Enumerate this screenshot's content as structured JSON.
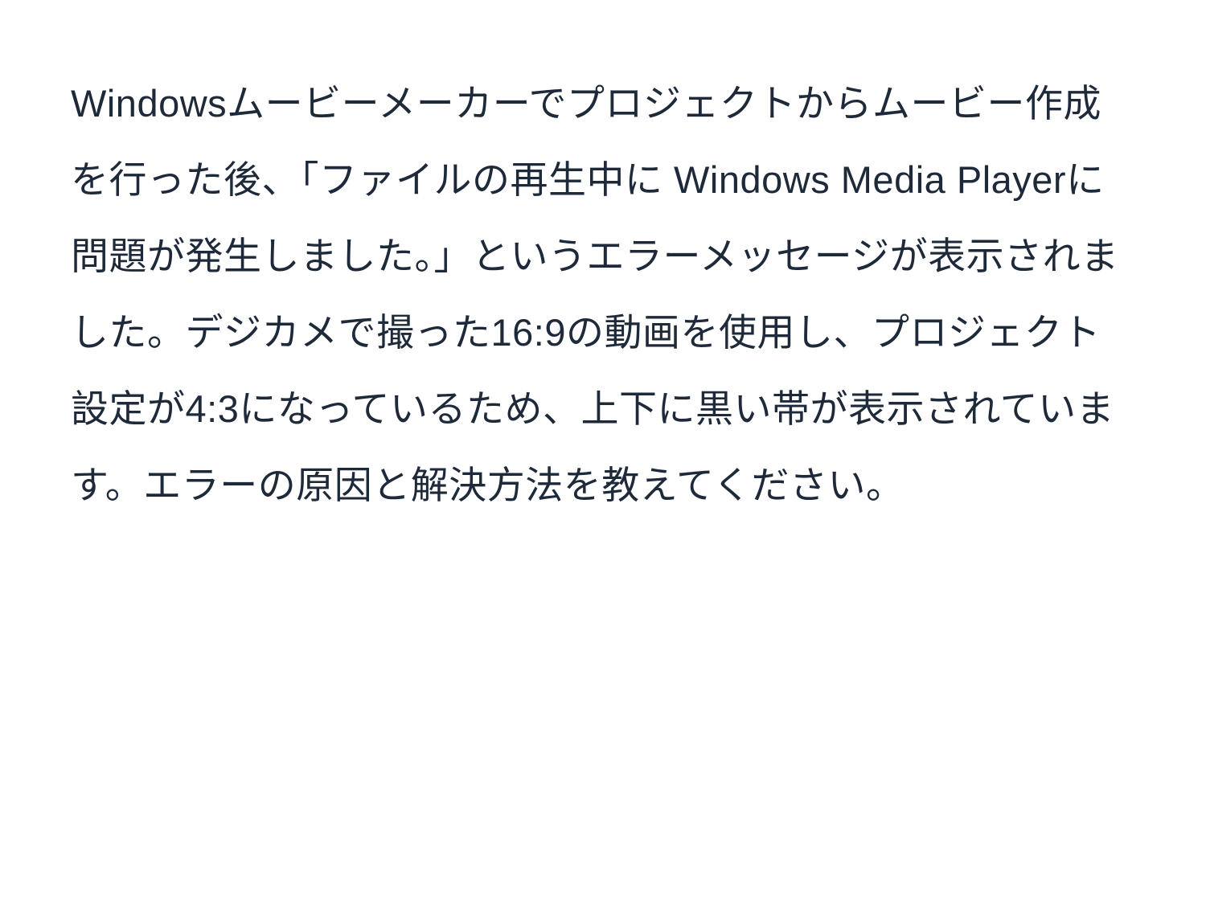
{
  "content": {
    "paragraph": "Windowsムービーメーカーでプロジェクトからムービー作成を行った後、「ファイルの再生中に Windows Media Playerに問題が発生しました。」というエラーメッセージが表示されました。デジカメで撮った16:9の動画を使用し、プロジェクト設定が4:3になっているため、上下に黒い帯が表示されています。エラーの原因と解決方法を教えてください。"
  }
}
